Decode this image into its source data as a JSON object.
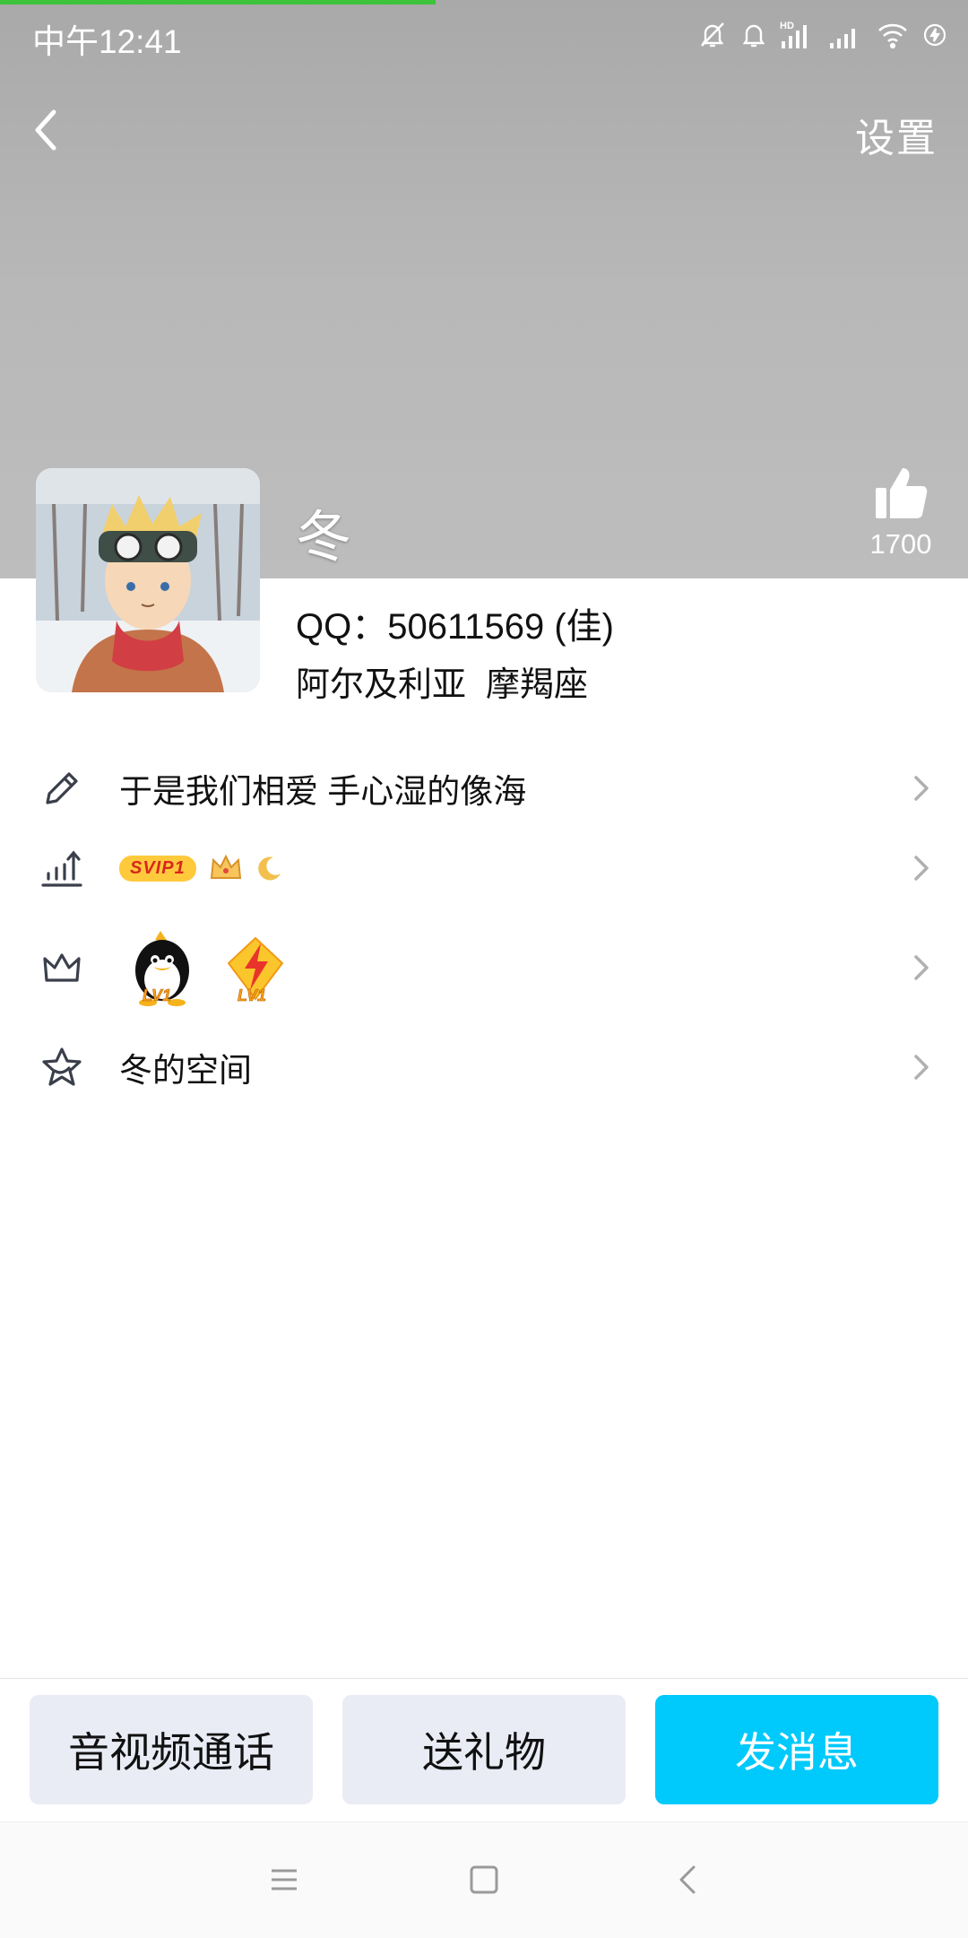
{
  "status_bar": {
    "time": "中午12:41",
    "icons": [
      "mute-bell-icon",
      "bell-icon",
      "hd-signal-icon",
      "signal-icon",
      "wifi-icon",
      "charging-icon"
    ],
    "hd_label": "HD"
  },
  "loading_progress": 0.45,
  "header": {
    "back_icon": "chevron-left-icon",
    "settings_label": "设置"
  },
  "profile": {
    "nickname": "冬",
    "qq_line": "QQ：50611569 (佳)",
    "region": "阿尔及利亚",
    "zodiac": "摩羯座",
    "like_count": "1700",
    "like_icon": "thumbs-up-icon"
  },
  "rows": [
    {
      "icon": "pencil-icon",
      "label": "于是我们相爱 手心湿的像海"
    },
    {
      "icon": "level-up-icon",
      "badge": "SVIP1"
    },
    {
      "icon": "crown-icon",
      "badges": [
        "LV1",
        "LV1"
      ]
    },
    {
      "icon": "star-icon",
      "label": "冬的空间"
    }
  ],
  "actions": {
    "call_label": "音视频通话",
    "gift_label": "送礼物",
    "message_label": "发消息"
  },
  "navbar": {
    "icons": [
      "menu-icon",
      "home-icon",
      "back-icon"
    ]
  },
  "colors": {
    "accent_blue": "#00c9fb",
    "progress_green": "#3dc43a",
    "svip_yellow": "#ffc93c"
  }
}
